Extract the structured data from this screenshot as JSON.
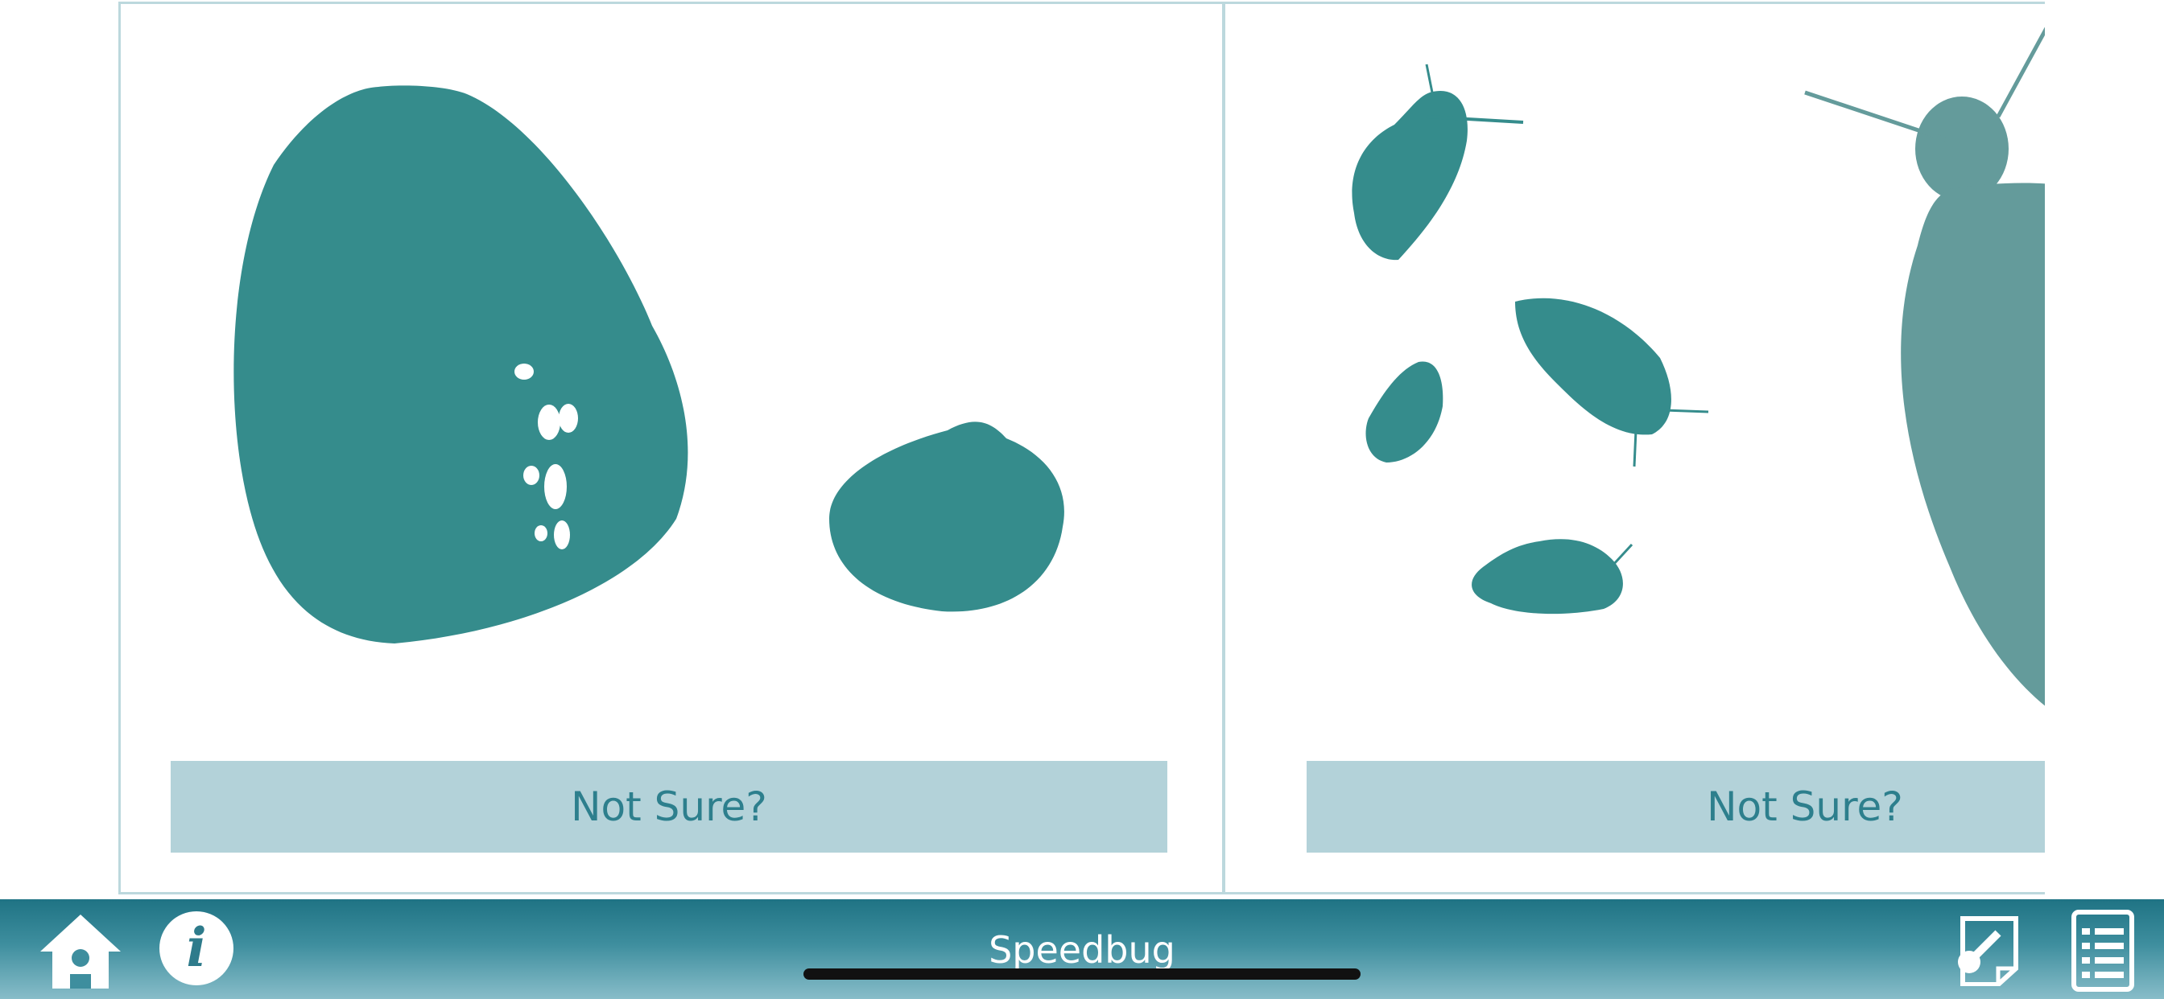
{
  "cards": [
    {
      "not_sure_label": "Not Sure?"
    },
    {
      "not_sure_label": "Not Sure?"
    }
  ],
  "toolbar": {
    "title": "Speedbug",
    "icons": [
      "home-icon",
      "info-icon",
      "key-document-icon",
      "list-icon"
    ]
  },
  "colors": {
    "accent": "#358c8c",
    "button_bg": "#b3d2d9",
    "button_text": "#2d7f8d",
    "toolbar_top": "#1f7384",
    "toolbar_bottom": "#88bdc9"
  }
}
